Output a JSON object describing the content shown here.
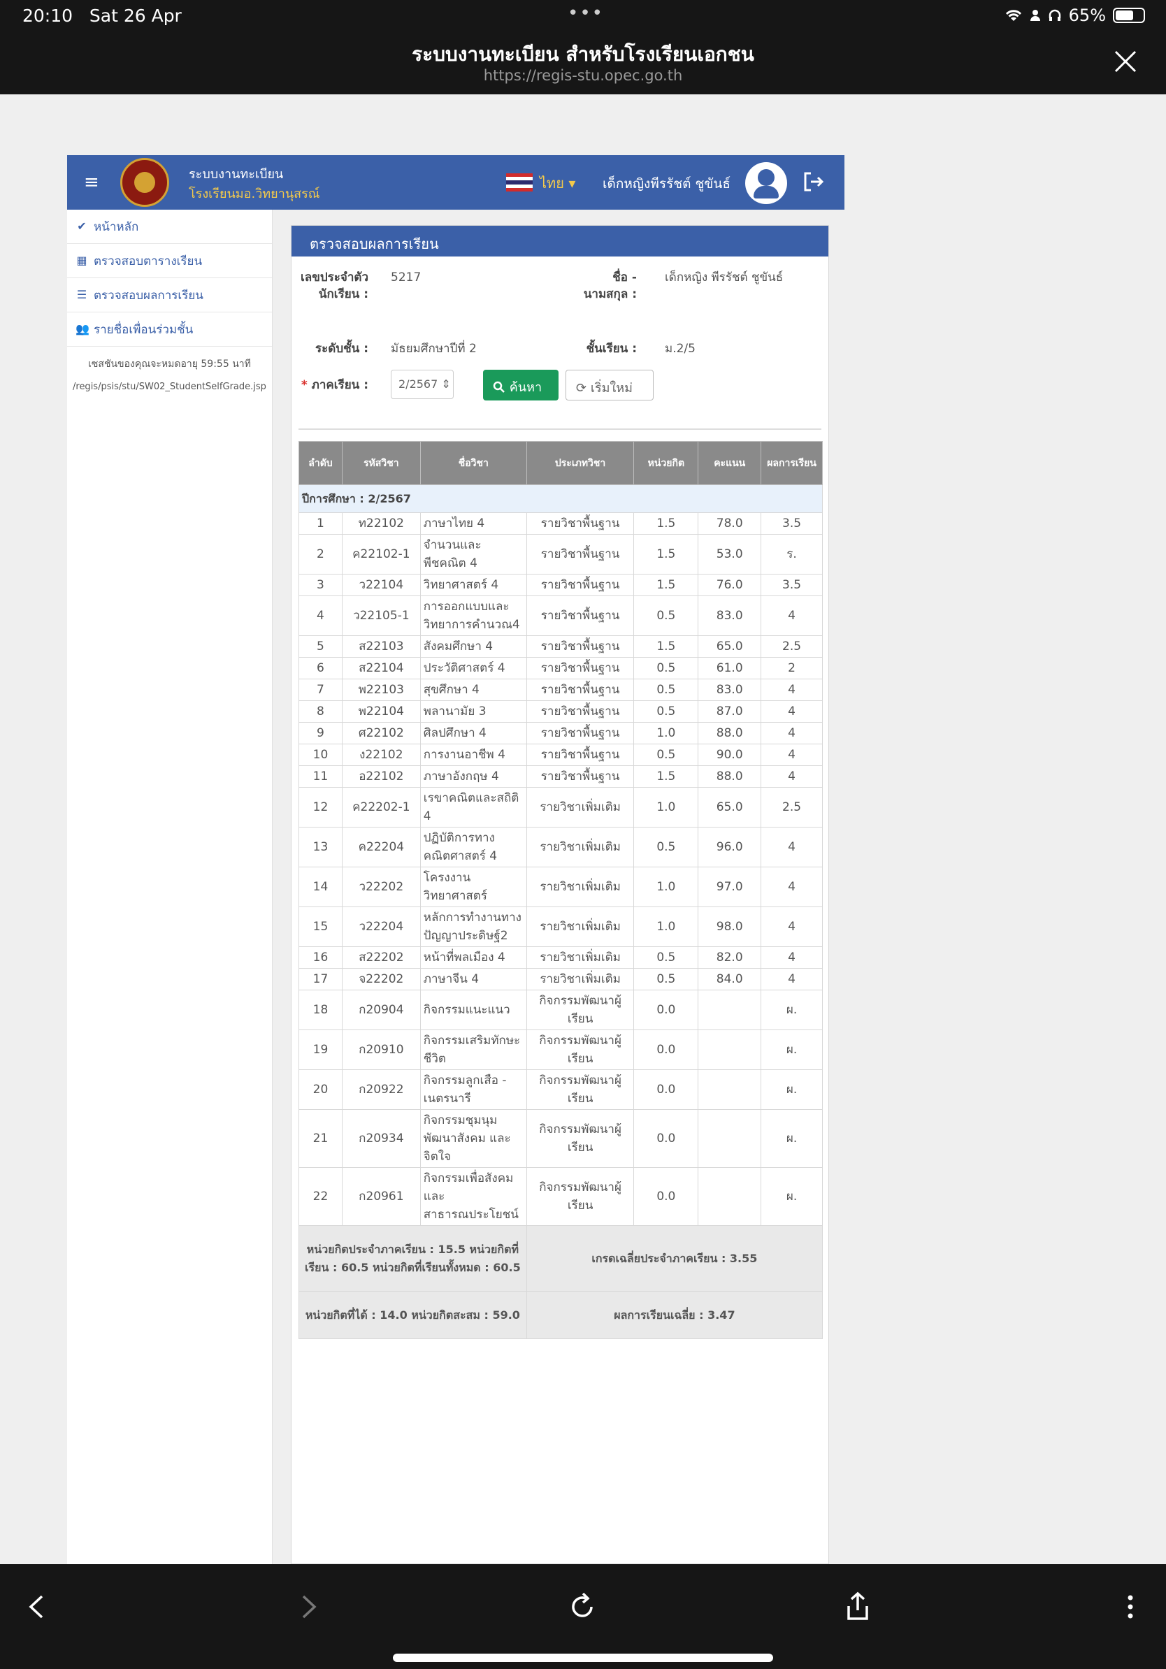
{
  "status": {
    "time": "20:10",
    "date": "Sat 26 Apr",
    "battery": "65%",
    "battery_level": 0.65
  },
  "browser": {
    "title": "ระบบงานทะเบียน สำหรับโรงเรียนเอกชน",
    "url": "https://regis-stu.opec.go.th"
  },
  "header": {
    "app_name": "ระบบงานทะเบียน",
    "school": "โรงเรียนมอ.วิทยานุสรณ์",
    "language": "ไทย",
    "user": "เด็กหญิงพีรรัชต์ ชูขันธ์"
  },
  "sidebar": {
    "items": [
      {
        "label": "หน้าหลัก",
        "icon": "check-circle-icon"
      },
      {
        "label": "ตรวจสอบตารางเรียน",
        "icon": "calendar-icon"
      },
      {
        "label": "ตรวจสอบผลการเรียน",
        "icon": "list-icon"
      },
      {
        "label": "รายชื่อเพื่อนร่วมชั้น",
        "icon": "users-icon"
      }
    ],
    "session": "เซสชันของคุณจะหมดอายุ 59:55 นาที",
    "path": "/regis/psis/stu/SW02_StudentSelfGrade.jsp"
  },
  "panel": {
    "title": "ตรวจสอบผลการเรียน",
    "student_id_label": "เลขประจำตัวนักเรียน :",
    "student_id": "5217",
    "name_label": "ชื่อ - นามสกุล :",
    "name": "เด็กหญิง พีรรัชต์ ชูขันธ์",
    "level_label": "ระดับชั้น :",
    "level": "มัธยมศึกษาปีที่ 2",
    "class_label": "ชั้นเรียน :",
    "class": "ม.2/5",
    "term_label": "ภาคเรียน :",
    "term_value": "2/2567",
    "search_label": "ค้นหา",
    "reset_label": "เริ่มใหม่"
  },
  "table": {
    "headers": [
      "ลำดับ",
      "รหัสวิชา",
      "ชื่อวิชา",
      "ประเภทวิชา",
      "หน่วยกิต",
      "คะแนน",
      "ผลการเรียน"
    ],
    "year_label": "ปีการศึกษา : 2/2567",
    "rows": [
      [
        "1",
        "ท22102",
        "ภาษาไทย 4",
        "รายวิชาพื้นฐาน",
        "1.5",
        "78.0",
        "3.5"
      ],
      [
        "2",
        "ค22102-1",
        "จำนวนและพีชคณิต 4",
        "รายวิชาพื้นฐาน",
        "1.5",
        "53.0",
        "ร."
      ],
      [
        "3",
        "ว22104",
        "วิทยาศาสตร์ 4",
        "รายวิชาพื้นฐาน",
        "1.5",
        "76.0",
        "3.5"
      ],
      [
        "4",
        "ว22105-1",
        "การออกแบบและวิทยาการคำนวณ4",
        "รายวิชาพื้นฐาน",
        "0.5",
        "83.0",
        "4"
      ],
      [
        "5",
        "ส22103",
        "สังคมศึกษา 4",
        "รายวิชาพื้นฐาน",
        "1.5",
        "65.0",
        "2.5"
      ],
      [
        "6",
        "ส22104",
        "ประวัติศาสตร์ 4",
        "รายวิชาพื้นฐาน",
        "0.5",
        "61.0",
        "2"
      ],
      [
        "7",
        "พ22103",
        "สุขศึกษา 4",
        "รายวิชาพื้นฐาน",
        "0.5",
        "83.0",
        "4"
      ],
      [
        "8",
        "พ22104",
        "พลานามัย 3",
        "รายวิชาพื้นฐาน",
        "0.5",
        "87.0",
        "4"
      ],
      [
        "9",
        "ศ22102",
        "ศิลปศึกษา 4",
        "รายวิชาพื้นฐาน",
        "1.0",
        "88.0",
        "4"
      ],
      [
        "10",
        "ง22102",
        "การงานอาชีพ 4",
        "รายวิชาพื้นฐาน",
        "0.5",
        "90.0",
        "4"
      ],
      [
        "11",
        "อ22102",
        "ภาษาอังกฤษ 4",
        "รายวิชาพื้นฐาน",
        "1.5",
        "88.0",
        "4"
      ],
      [
        "12",
        "ค22202-1",
        "เรขาคณิตและสถิติ 4",
        "รายวิชาเพิ่มเติม",
        "1.0",
        "65.0",
        "2.5"
      ],
      [
        "13",
        "ค22204",
        "ปฏิบัติการทางคณิตศาสตร์ 4",
        "รายวิชาเพิ่มเติม",
        "0.5",
        "96.0",
        "4"
      ],
      [
        "14",
        "ว22202",
        "โครงงานวิทยาศาสตร์",
        "รายวิชาเพิ่มเติม",
        "1.0",
        "97.0",
        "4"
      ],
      [
        "15",
        "ว22204",
        "หลักการทำงานทางปัญญาประดิษฐ์2",
        "รายวิชาเพิ่มเติม",
        "1.0",
        "98.0",
        "4"
      ],
      [
        "16",
        "ส22202",
        "หน้าที่พลเมือง 4",
        "รายวิชาเพิ่มเติม",
        "0.5",
        "82.0",
        "4"
      ],
      [
        "17",
        "จ22202",
        "ภาษาจีน 4",
        "รายวิชาเพิ่มเติม",
        "0.5",
        "84.0",
        "4"
      ],
      [
        "18",
        "ก20904",
        "กิจกรรมแนะแนว",
        "กิจกรรมพัฒนาผู้เรียน",
        "0.0",
        "",
        "ผ."
      ],
      [
        "19",
        "ก20910",
        "กิจกรรมเสริมทักษะชีวิต",
        "กิจกรรมพัฒนาผู้เรียน",
        "0.0",
        "",
        "ผ."
      ],
      [
        "20",
        "ก20922",
        "กิจกรรมลูกเสือ - เนตรนารี",
        "กิจกรรมพัฒนาผู้เรียน",
        "0.0",
        "",
        "ผ."
      ],
      [
        "21",
        "ก20934",
        "กิจกรรมชุมนุมพัฒนาสังคม และจิตใจ",
        "กิจกรรมพัฒนาผู้เรียน",
        "0.0",
        "",
        "ผ."
      ],
      [
        "22",
        "ก20961",
        "กิจกรรมเพื่อสังคม และสาธารณประโยชน์",
        "กิจกรรมพัฒนาผู้เรียน",
        "0.0",
        "",
        "ผ."
      ]
    ],
    "summary1_left": "หน่วยกิตประจำภาคเรียน : 15.5 หน่วยกิตที่เรียน : 60.5 หน่วยกิตที่เรียนทั้งหมด : 60.5",
    "summary1_right": "เกรดเฉลี่ยประจำภาคเรียน : 3.55",
    "summary2_left": "หน่วยกิตที่ได้ : 14.0 หน่วยกิตสะสม : 59.0",
    "summary2_right": "ผลการเรียนเฉลี่ย : 3.47"
  }
}
